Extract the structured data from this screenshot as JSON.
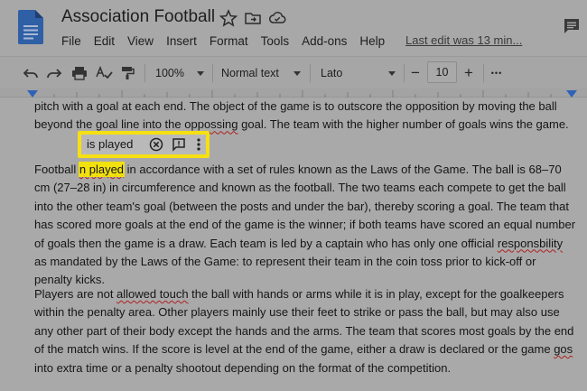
{
  "doc": {
    "title": "Association Football"
  },
  "menu": [
    "File",
    "Edit",
    "View",
    "Insert",
    "Format",
    "Tools",
    "Add-ons",
    "Help"
  ],
  "last_edit": "Last edit was 13 min...",
  "toolbar": {
    "zoom": "100%",
    "style": "Normal text",
    "font": "Lato",
    "font_size": "10",
    "minus": "−",
    "plus": "+",
    "more": "•••"
  },
  "suggestion": {
    "text": "is played"
  },
  "body": {
    "p1a": "pitch with a goal at each end. The object of the game is to outscore the opposition by moving the ball beyond the goal line into the ",
    "p1_err": "oppossing",
    "p1b": " goal. The team with the higher number of goals wins the game.",
    "p2_start": "Football ",
    "p2_err": "n played",
    "p2a": " in accordance with a set of rules known as the Laws of the Game. The ball is 68–70 cm (27–28 in) in circumference and known as the football. The two teams each compete to get the ball into the other team's goal (between the posts and under the bar), thereby scoring a goal. The team that has scored more goals at the end of the game is the winner; if both teams have scored an equal number of goals then the game is a draw. Each team is led by a captain who has only one official ",
    "p2_err2": "responsbility",
    "p2b": " as mandated by the Laws of the Game: to represent their team in the coin toss prior to kick-off or penalty kicks.",
    "p3a": "Players are not ",
    "p3_err": "allowed touch",
    "p3b": " the ball with hands or arms while it is in play, except for the goalkeepers within the penalty area. Other players mainly use their feet to strike or pass the ball, but may also use any other part of their body except the hands and the arms. The team that scores most goals by the end of the match wins. If the score is level at the end of the game, either a draw is declared or the game ",
    "p3_err2": "gos",
    "p3c": " into extra time or a penalty shootout depending on the format of the competition."
  }
}
